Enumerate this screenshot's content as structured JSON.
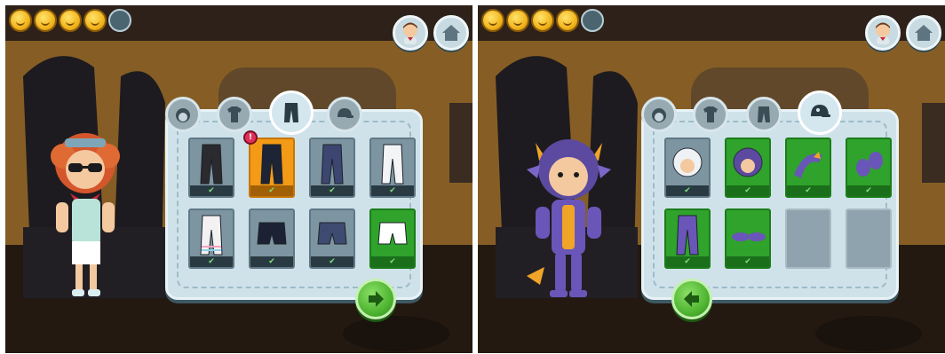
{
  "colors": {
    "wall_dark": "#3a2a1d",
    "wall_amber": "#c98d2c",
    "floor": "#2a1e16",
    "board": "#cfe2ea",
    "slot_selected": "#2fa32c",
    "slot_highlight": "#f39a16",
    "coin_gold": "#f2b51c"
  },
  "screens": [
    {
      "id": "left",
      "coins": {
        "filled": 4,
        "total": 5
      },
      "top_buttons": [
        {
          "name": "character-avatar-button",
          "icon": "boy-avatar-icon"
        },
        {
          "name": "home-button",
          "icon": "home-icon"
        }
      ],
      "tabs": [
        {
          "name": "hair",
          "icon": "hair-icon",
          "active": false
        },
        {
          "name": "tops",
          "icon": "shirt-icon",
          "active": false
        },
        {
          "name": "bottoms",
          "icon": "pants-icon",
          "active": true
        },
        {
          "name": "hats",
          "icon": "cap-icon",
          "active": false
        }
      ],
      "items": [
        {
          "name": "black-pants",
          "state": "owned",
          "color": "#2b2a2e",
          "shape": "pants"
        },
        {
          "name": "navy-pants",
          "state": "highlighted",
          "color": "#1d2436",
          "shape": "pants",
          "badge": "!"
        },
        {
          "name": "blue-jeans",
          "state": "owned",
          "color": "#3d4670",
          "shape": "pants"
        },
        {
          "name": "white-pants",
          "state": "owned",
          "color": "#f2f4f6",
          "shape": "pants"
        },
        {
          "name": "striped-leggings",
          "state": "owned",
          "color": "#f4f1f2",
          "shape": "pants"
        },
        {
          "name": "navy-shorts",
          "state": "owned",
          "color": "#1c2233",
          "shape": "shorts"
        },
        {
          "name": "denim-shorts",
          "state": "owned",
          "color": "#3f4a70",
          "shape": "shorts"
        },
        {
          "name": "white-shorts",
          "state": "selected",
          "color": "#ffffff",
          "shape": "shorts"
        }
      ],
      "nav_arrow": "right-arrow-icon"
    },
    {
      "id": "right",
      "coins": {
        "filled": 4,
        "total": 5
      },
      "top_buttons": [
        {
          "name": "character-avatar-button",
          "icon": "boy-avatar-icon"
        },
        {
          "name": "home-button",
          "icon": "home-icon"
        }
      ],
      "tabs": [
        {
          "name": "hair",
          "icon": "hair-icon",
          "active": false
        },
        {
          "name": "tops",
          "icon": "shirt-icon",
          "active": false
        },
        {
          "name": "bottoms",
          "icon": "pants-icon",
          "active": false
        },
        {
          "name": "hats",
          "icon": "cap-icon",
          "active": true
        }
      ],
      "items": [
        {
          "name": "white-ghost-hat",
          "state": "owned",
          "color": "#eef2f4",
          "shape": "head"
        },
        {
          "name": "monster-head",
          "state": "selected",
          "color": "#5b4aa0",
          "shape": "head"
        },
        {
          "name": "monster-tail",
          "state": "selected",
          "color": "#6a56b8",
          "shape": "tail"
        },
        {
          "name": "monster-gloves",
          "state": "selected",
          "color": "#6a56b8",
          "shape": "gloves"
        },
        {
          "name": "monster-legs",
          "state": "selected",
          "color": "#6a56b8",
          "shape": "pants"
        },
        {
          "name": "monster-shoes",
          "state": "selected",
          "color": "#6a56b8",
          "shape": "shoes"
        },
        {
          "name": "empty-slot",
          "state": "empty"
        },
        {
          "name": "empty-slot",
          "state": "empty"
        }
      ],
      "nav_arrow": "left-arrow-icon"
    }
  ],
  "check_mark": "✔"
}
